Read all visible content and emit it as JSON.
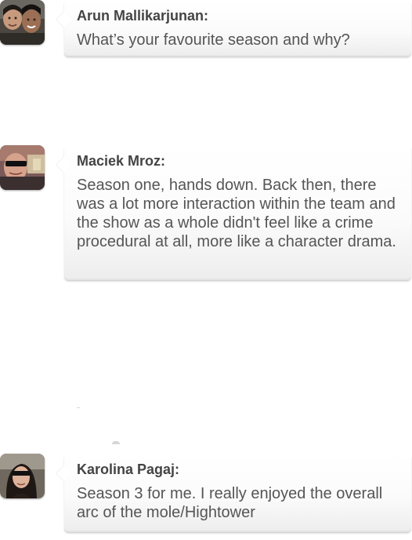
{
  "messages": [
    {
      "author": "Arun Mallikarjunan:",
      "text": "What’s your favourite season and why?",
      "avatar": "avatar-arun"
    },
    {
      "author": "Maciek Mroz:",
      "text": "Season one, hands down. Back then, there was a lot more interaction within the team and the show as a whole didn't feel like a crime procedural at all, more like a character drama.",
      "avatar": "avatar-maciek"
    },
    {
      "author": "Karolina Pagaj:",
      "text": "Season 3 for me. I really enjoyed the overall arc of the mole/Hightower",
      "avatar": "avatar-karolina"
    }
  ],
  "colors": {
    "bubble_background": "#ffffff",
    "bubble_shadow": "#e6e6e6",
    "author_text": "#444444",
    "message_text": "#555555"
  }
}
